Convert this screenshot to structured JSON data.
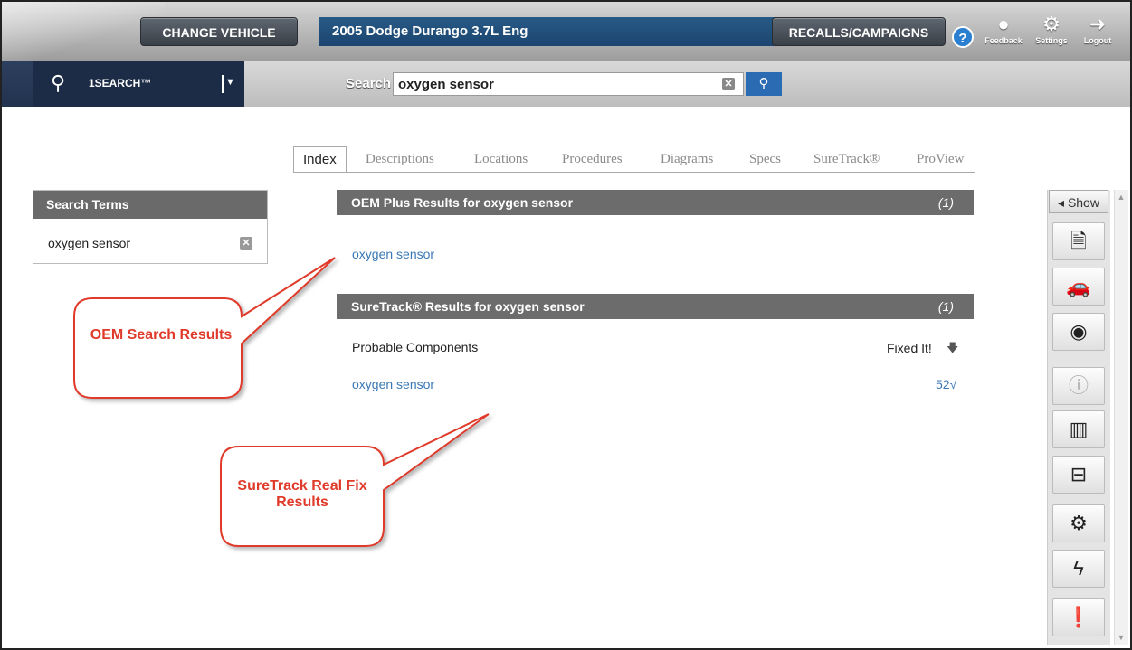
{
  "topbar": {
    "change_vehicle": "CHANGE VEHICLE",
    "vehicle": "2005 Dodge Durango 3.7L Eng",
    "recalls": "RECALLS/CAMPAIGNS",
    "help": "?",
    "feedback_label": "Feedback",
    "settings_label": "Settings",
    "logout_label": "Logout"
  },
  "searchbar": {
    "product": "1SEARCH™",
    "search_label": "Search",
    "query": "oxygen sensor",
    "clear": "✕",
    "go": "Q"
  },
  "tabs": [
    "Index",
    "Descriptions",
    "Locations",
    "Procedures",
    "Diagrams",
    "Specs",
    "SureTrack®",
    "ProView"
  ],
  "terms": {
    "title": "Search Terms",
    "items": [
      "oxygen sensor"
    ]
  },
  "oem": {
    "title": "OEM Plus Results for oxygen sensor",
    "count": "(1)",
    "link": "oxygen sensor"
  },
  "suretrack": {
    "title": "SureTrack® Results for oxygen sensor",
    "count": "(1)",
    "probable_label": "Probable Components",
    "fixed_label": "Fixed It!",
    "link": "oxygen sensor",
    "fixed_count": "52√"
  },
  "callouts": {
    "oem": "OEM Search Results",
    "suretrack": "SureTrack Real Fix Results"
  },
  "sidebar": {
    "show": "Show",
    "tools": [
      "info-doc-icon",
      "vehicle-component-icon",
      "gauge-icon",
      "warning-icon",
      "manual-book-icon",
      "connector-icon",
      "engine-icon",
      "wiring-location-icon",
      "alert-doc-icon"
    ]
  },
  "colors": {
    "vehicle_bar": "#1b4570",
    "search_blue": "#2b6bb3",
    "link_blue": "#3a78b5",
    "callout_red": "#e03a2a",
    "header_gray": "#6c6c6c"
  }
}
